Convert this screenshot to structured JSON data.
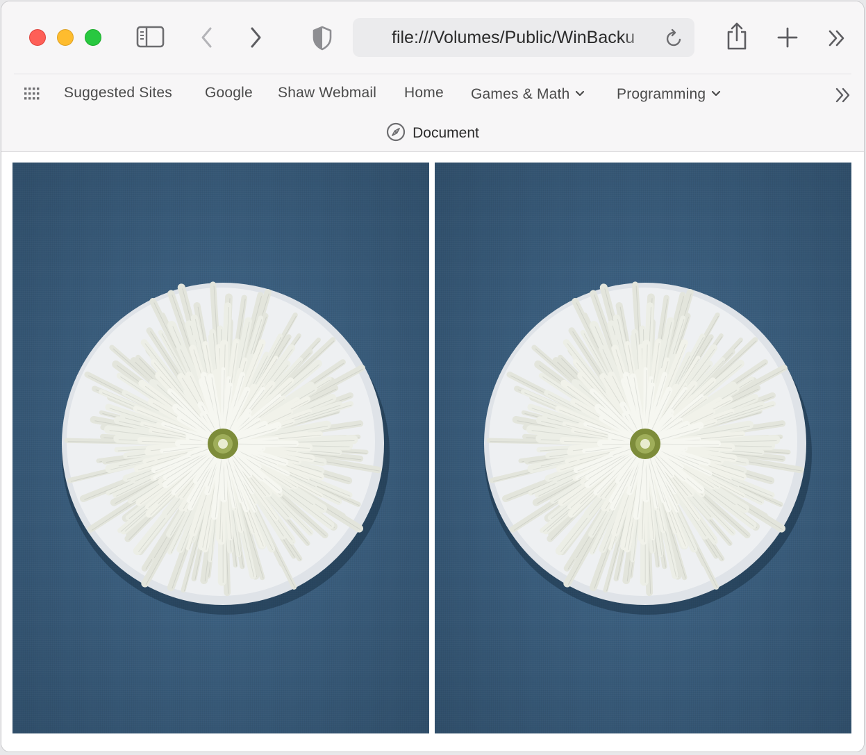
{
  "window": {
    "controls": {
      "close": "close",
      "minimize": "minimize",
      "zoom": "zoom"
    }
  },
  "toolbar": {
    "icons": [
      "sidebar-icon",
      "back-icon",
      "forward-icon",
      "shield-icon",
      "share-icon",
      "new-tab-icon",
      "overflow-chevron-icon"
    ],
    "address": "file:///Volumes/Public/WinBacku"
  },
  "bookmarks": {
    "items": [
      {
        "label": "Suggested Sites",
        "menu": false
      },
      {
        "label": "Google",
        "menu": false
      },
      {
        "label": "Shaw Webmail",
        "menu": false
      },
      {
        "label": "Home",
        "menu": false
      },
      {
        "label": "Games & Math",
        "menu": true
      },
      {
        "label": "Programming",
        "menu": true
      }
    ]
  },
  "tab": {
    "title": "Document",
    "icon": "compass-icon"
  },
  "content": {
    "images": [
      {
        "subject": "white chrysanthemum on plate, blue linen"
      },
      {
        "subject": "white chrysanthemum on plate, blue linen"
      }
    ],
    "colors": {
      "background": "#3b5f7f",
      "plate": "#eef0f2",
      "petals": "#f1f2ea",
      "center": "#9fae5a"
    }
  }
}
